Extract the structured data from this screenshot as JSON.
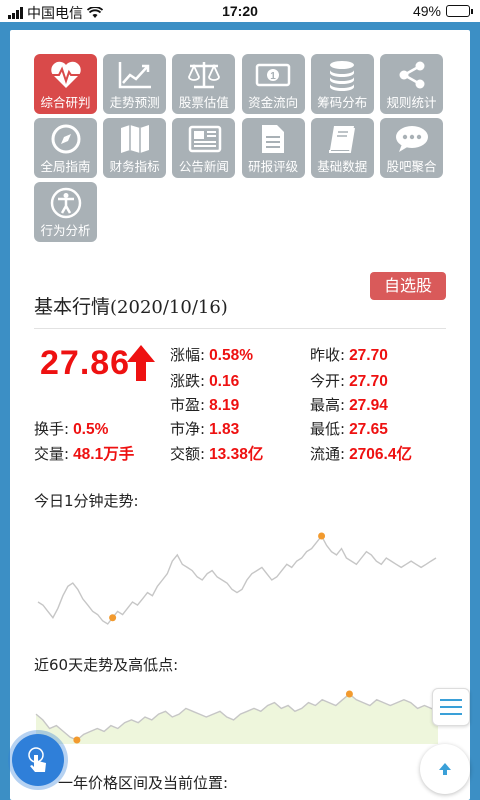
{
  "status": {
    "carrier": "中国电信",
    "time": "17:20",
    "battery": "49%",
    "battery_level": 0.49
  },
  "tools": [
    {
      "label": "综合研判",
      "icon": "heart-pulse-icon",
      "active": true
    },
    {
      "label": "走势预测",
      "icon": "trend-chart-icon",
      "active": false
    },
    {
      "label": "股票估值",
      "icon": "balance-scale-icon",
      "active": false
    },
    {
      "label": "资金流向",
      "icon": "banknote-icon",
      "active": false
    },
    {
      "label": "筹码分布",
      "icon": "coin-stack-icon",
      "active": false
    },
    {
      "label": "规则统计",
      "icon": "share-nodes-icon",
      "active": false
    },
    {
      "label": "全局指南",
      "icon": "compass-icon",
      "active": false
    },
    {
      "label": "财务指标",
      "icon": "map-icon",
      "active": false
    },
    {
      "label": "公告新闻",
      "icon": "newspaper-icon",
      "active": false
    },
    {
      "label": "研报评级",
      "icon": "document-icon",
      "active": false
    },
    {
      "label": "基础数据",
      "icon": "book-icon",
      "active": false
    },
    {
      "label": "股吧聚合",
      "icon": "chat-bubble-icon",
      "active": false
    },
    {
      "label": "行为分析",
      "icon": "accessibility-icon",
      "active": false
    }
  ],
  "favorite_label": "自选股",
  "section": {
    "title": "基本行情",
    "date": "(2020/10/16)"
  },
  "quote": {
    "price": "27.86",
    "change_pct": {
      "label": "涨幅:",
      "value": "0.58%"
    },
    "change": {
      "label": "涨跌:",
      "value": "0.16"
    },
    "pe": {
      "label": "市盈:",
      "value": "8.19"
    },
    "pb": {
      "label": "市净:",
      "value": "1.83"
    },
    "amount": {
      "label": "交额:",
      "value": "13.38亿"
    },
    "prev_close": {
      "label": "昨收:",
      "value": "27.70"
    },
    "open": {
      "label": "今开:",
      "value": "27.70"
    },
    "high": {
      "label": "最高:",
      "value": "27.94"
    },
    "low": {
      "label": "最低:",
      "value": "27.65"
    },
    "float_cap": {
      "label": "流通:",
      "value": "2706.4亿"
    },
    "turnover": {
      "label": "换手:",
      "value": "0.5%"
    },
    "volume": {
      "label": "交量:",
      "value": "48.1万手"
    }
  },
  "minute_chart": {
    "title": "今日1分钟走势:",
    "values": [
      27.73,
      27.72,
      27.7,
      27.68,
      27.71,
      27.75,
      27.78,
      27.79,
      27.77,
      27.74,
      27.72,
      27.7,
      27.69,
      27.67,
      27.66,
      27.68,
      27.7,
      27.69,
      27.71,
      27.73,
      27.72,
      27.74,
      27.76,
      27.75,
      27.78,
      27.8,
      27.82,
      27.86,
      27.88,
      27.85,
      27.84,
      27.83,
      27.81,
      27.8,
      27.82,
      27.83,
      27.81,
      27.8,
      27.79,
      27.77,
      27.76,
      27.77,
      27.8,
      27.82,
      27.83,
      27.84,
      27.82,
      27.8,
      27.81,
      27.83,
      27.85,
      27.84,
      27.86,
      27.87,
      27.89,
      27.9,
      27.92,
      27.94,
      27.91,
      27.89,
      27.88,
      27.9,
      27.87,
      27.86,
      27.85,
      27.87,
      27.89,
      27.88,
      27.86,
      27.85,
      27.87,
      27.86,
      27.85,
      27.84,
      27.85,
      27.86,
      27.85,
      27.84,
      27.85,
      27.86,
      27.87
    ],
    "low_index": 15,
    "high_index": 57
  },
  "day60_chart": {
    "title": "近60天走势及高低点:",
    "values": [
      27.1,
      26.9,
      26.6,
      26.7,
      26.5,
      26.3,
      26.2,
      26.4,
      26.5,
      26.6,
      26.5,
      26.7,
      26.6,
      26.8,
      26.9,
      26.8,
      27.0,
      26.9,
      27.1,
      27.2,
      27.0,
      27.1,
      27.3,
      27.2,
      27.1,
      27.0,
      27.1,
      27.2,
      27.0,
      26.9,
      27.1,
      27.2,
      27.3,
      27.2,
      27.4,
      27.5,
      27.3,
      27.4,
      27.2,
      27.3,
      27.5,
      27.4,
      27.6,
      27.5,
      27.4,
      27.6,
      27.8,
      27.6,
      27.5,
      27.4,
      27.6,
      27.5,
      27.4,
      27.5,
      27.6,
      27.5,
      27.3,
      27.4,
      27.3,
      27.2
    ],
    "low_index": 6,
    "high_index": 46
  },
  "next_section_title": "一年价格区间及当前位置:"
}
